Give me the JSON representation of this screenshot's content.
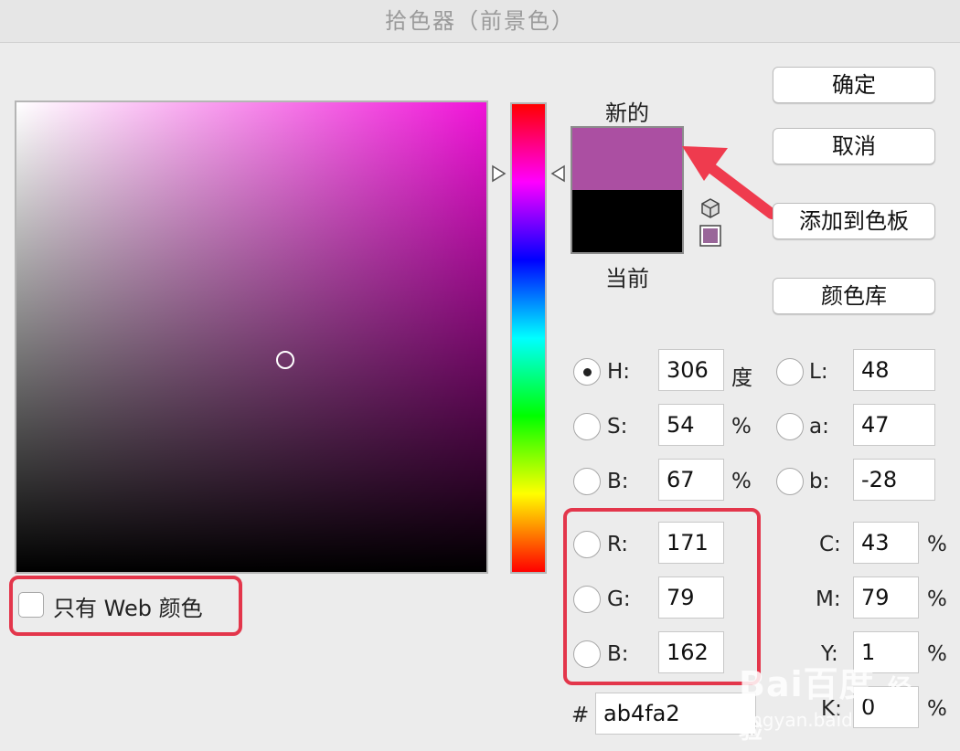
{
  "window": {
    "title": "拾色器（前景色）"
  },
  "preview": {
    "new_label": "新的",
    "current_label": "当前",
    "new_color": "#ab4fa2",
    "current_color": "#000000"
  },
  "buttons": {
    "ok": "确定",
    "cancel": "取消",
    "add_to_swatches": "添加到色板",
    "color_libraries": "颜色库"
  },
  "hsb": {
    "h": {
      "label": "H:",
      "value": "306",
      "unit": "度",
      "selected": true
    },
    "s": {
      "label": "S:",
      "value": "54",
      "unit": "%"
    },
    "b": {
      "label": "B:",
      "value": "67",
      "unit": "%"
    }
  },
  "rgb": {
    "r": {
      "label": "R:",
      "value": "171"
    },
    "g": {
      "label": "G:",
      "value": "79"
    },
    "b": {
      "label": "B:",
      "value": "162"
    }
  },
  "lab": {
    "l": {
      "label": "L:",
      "value": "48"
    },
    "a": {
      "label": "a:",
      "value": "47"
    },
    "b": {
      "label": "b:",
      "value": "-28"
    }
  },
  "cmyk": {
    "c": {
      "label": "C:",
      "value": "43",
      "unit": "%"
    },
    "m": {
      "label": "M:",
      "value": "79",
      "unit": "%"
    },
    "y": {
      "label": "Y:",
      "value": "1",
      "unit": "%"
    },
    "k": {
      "label": "K:",
      "value": "0",
      "unit": "%"
    }
  },
  "hex": {
    "label": "#",
    "value": "ab4fa2"
  },
  "web_only": {
    "label": "只有 Web 颜色",
    "checked": false
  },
  "annotation": {
    "highlight_color": "#e3364b"
  },
  "watermark": {
    "brand": "Bai百度",
    "sub": "jingyan.baidu.com",
    "extra": "经验"
  },
  "icons": {
    "gamut_warning": "cube-icon",
    "websafe_swatch": "websafe-swatch-icon"
  }
}
